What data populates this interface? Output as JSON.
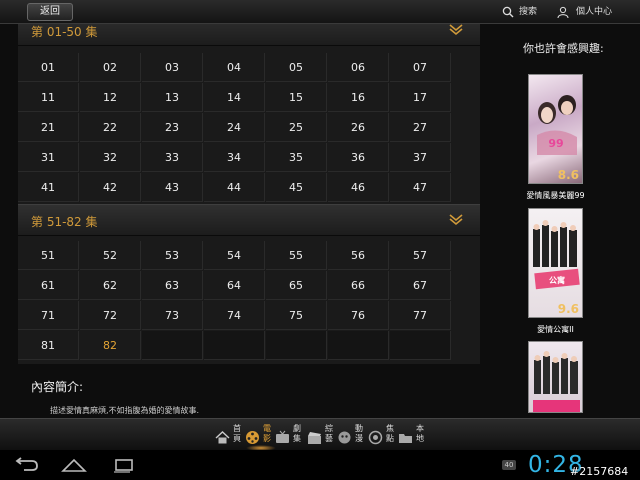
{
  "topbar": {
    "back_label": "返回",
    "search_label": "搜索",
    "user_label": "個人中心"
  },
  "sections": [
    {
      "title": "第 01-50 集",
      "rows": [
        [
          "01",
          "02",
          "03",
          "04",
          "05",
          "06",
          "07"
        ],
        [
          "11",
          "12",
          "13",
          "14",
          "15",
          "16",
          "17"
        ],
        [
          "21",
          "22",
          "23",
          "24",
          "25",
          "26",
          "27"
        ],
        [
          "31",
          "32",
          "33",
          "34",
          "35",
          "36",
          "37"
        ],
        [
          "41",
          "42",
          "43",
          "44",
          "45",
          "46",
          "47"
        ]
      ]
    },
    {
      "title": "第 51-82 集",
      "rows": [
        [
          "51",
          "52",
          "53",
          "54",
          "55",
          "56",
          "57"
        ],
        [
          "61",
          "62",
          "63",
          "64",
          "65",
          "66",
          "67"
        ],
        [
          "71",
          "72",
          "73",
          "74",
          "75",
          "76",
          "77"
        ],
        [
          "81",
          "82"
        ]
      ],
      "current": "82"
    }
  ],
  "intro": {
    "title": "內容簡介:",
    "text": "描述愛情真麻煩,不如指腹為婚的愛情故事."
  },
  "recommend": {
    "title": "你也許會感興趣:",
    "items": [
      {
        "name": "愛情風暴美麗99",
        "score": "8.6"
      },
      {
        "name": "愛情公寓II",
        "score": "9.6"
      },
      {
        "name": "",
        "score": ""
      }
    ]
  },
  "nav": [
    {
      "label": "首頁",
      "icon": "home-icon"
    },
    {
      "label": "電影",
      "icon": "film-reel-icon",
      "active": true
    },
    {
      "label": "劇集",
      "icon": "tv-icon"
    },
    {
      "label": "綜藝",
      "icon": "clapper-icon"
    },
    {
      "label": "動漫",
      "icon": "anime-icon"
    },
    {
      "label": "焦點",
      "icon": "focus-icon"
    },
    {
      "label": "本地",
      "icon": "folder-icon"
    }
  ],
  "system": {
    "time": "0:28",
    "badge": "40",
    "watermark": "#2157684"
  },
  "colors": {
    "accent": "#e3a434",
    "clock": "#33b5e5"
  }
}
